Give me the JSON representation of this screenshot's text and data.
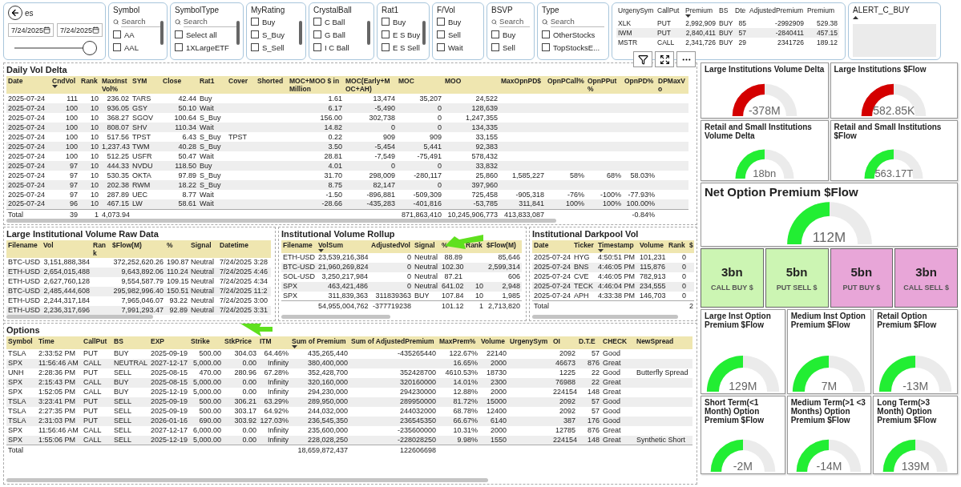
{
  "slicers": [
    {
      "kind": "date",
      "title": "es",
      "from": "7/24/2025",
      "to": "7/24/2025",
      "level": 1
    },
    {
      "kind": "list",
      "title": "Symbol",
      "search": {
        "placeholder": "Search"
      },
      "scrollbar": true,
      "items": [
        {
          "label": "AA",
          "checked": false
        },
        {
          "label": "AAL",
          "checked": false
        }
      ]
    },
    {
      "kind": "list",
      "title": "SymbolType",
      "search": {
        "placeholder": "Search"
      },
      "scrollbar": true,
      "items": [
        {
          "label": "Select all",
          "checked": false
        },
        {
          "label": "1XLargeETF",
          "checked": false
        }
      ]
    },
    {
      "kind": "list",
      "title": "MyRating",
      "scrollbar": true,
      "items": [
        {
          "label": "Buy",
          "checked": false
        },
        {
          "label": "S_Buy",
          "checked": false
        },
        {
          "label": "S_Sell",
          "checked": false
        }
      ]
    },
    {
      "kind": "list",
      "title": "CrystalBall",
      "scrollbar": true,
      "items": [
        {
          "label": "C Ball",
          "checked": false
        },
        {
          "label": "G Ball",
          "checked": false
        },
        {
          "label": "I C Ball",
          "checked": false
        }
      ]
    },
    {
      "kind": "list",
      "title": "Rat1",
      "scrollbar": true,
      "items": [
        {
          "label": "Buy",
          "checked": false
        },
        {
          "label": "E S Buy",
          "checked": false
        },
        {
          "label": "E S Sell",
          "checked": false
        }
      ]
    },
    {
      "kind": "list",
      "title": "F/Vol",
      "scrollbar": false,
      "items": [
        {
          "label": "Buy",
          "checked": false
        },
        {
          "label": "Sell",
          "checked": false
        },
        {
          "label": "Wait",
          "checked": false
        }
      ]
    },
    {
      "kind": "list",
      "title": "BSVP",
      "search": {
        "placeholder": "Search"
      },
      "scrollbar": false,
      "items": [
        {
          "label": "Buy",
          "checked": false
        },
        {
          "label": "Sell",
          "checked": false
        }
      ]
    },
    {
      "kind": "list",
      "title": "Type",
      "search": {
        "placeholder": "Search"
      },
      "scrollbar": false,
      "items": [
        {
          "label": "OtherStocks",
          "checked": false
        },
        {
          "label": "TopStocksE...",
          "checked": false
        }
      ]
    }
  ],
  "urgency_table": {
    "columns": [
      {
        "label": "UrgenySym",
        "sorted": false
      },
      {
        "label": "CallPut",
        "sorted": false
      },
      {
        "label": "Premium",
        "sorted": true
      },
      {
        "label": "BS",
        "sorted": false
      },
      {
        "label": "Dte",
        "sorted": false
      },
      {
        "label": "AdjustedPremium",
        "sorted": false
      },
      {
        "label": "Premium",
        "sorted": false
      }
    ],
    "rows": [
      {
        "urgeny_sym": "XLK",
        "call_put": "PUT",
        "premium": "2,992,909",
        "bs": "BUY",
        "dte": "85",
        "adjusted_premium": "-2992909",
        "column_7": "529.38"
      },
      {
        "urgeny_sym": "IWM",
        "call_put": "PUT",
        "premium": "2,840,411",
        "bs": "BUY",
        "dte": "57",
        "adjusted_premium": "-2840411",
        "column_7": "457.15"
      },
      {
        "urgeny_sym": "MSTR",
        "call_put": "CALL",
        "premium": "2,341,726",
        "bs": "BUY",
        "dte": "29",
        "adjusted_premium": "2341726",
        "column_7": "189.12"
      }
    ]
  },
  "alert_slicer": {
    "title": "ALERT_C_BUY"
  },
  "daily_vol_delta": {
    "title": "Daily Vol Delta",
    "columns": [
      {
        "label": "Date",
        "sorted": false
      },
      {
        "label": "CndVol",
        "sorted": true
      },
      {
        "label": "Rank",
        "sorted": false
      },
      {
        "label": "MaxInst Vol%",
        "sorted": false
      },
      {
        "label": "SYM",
        "sorted": false
      },
      {
        "label": "Close",
        "sorted": false
      },
      {
        "label": "Rat1",
        "sorted": false
      },
      {
        "label": "Cover",
        "sorted": false
      },
      {
        "label": "Shorted",
        "sorted": false
      },
      {
        "label": "MOC+MOO $ in Million",
        "sorted": false
      },
      {
        "label": "MOC(Early+MOC+AH)",
        "sorted": false
      },
      {
        "label": "MOC",
        "sorted": false
      },
      {
        "label": "MOO",
        "sorted": false
      },
      {
        "label": "MaxOpnPD$",
        "sorted": false
      },
      {
        "label": "OpnPCall%",
        "sorted": false
      },
      {
        "label": "OpnPPut%",
        "sorted": false
      },
      {
        "label": "OpnPD%",
        "sorted": false
      },
      {
        "label": "DPMaxVo",
        "sorted": false
      }
    ],
    "rows": [
      {
        "date": "2025-07-24",
        "cnd_vol": "111",
        "rank": "10",
        "max_inst_vol": "236.02",
        "sym": "TARS",
        "close": "42.44",
        "rat1": "Buy",
        "moc_moo_million": "1.61",
        "moc_early": "13,474",
        "moc": "35,207",
        "moo": "24,522"
      },
      {
        "date": "2025-07-24",
        "cnd_vol": "100",
        "rank": "10",
        "max_inst_vol": "936.05",
        "sym": "GSY",
        "close": "50.10",
        "rat1": "Wait",
        "moc_moo_million": "6.17",
        "moc_early": "-5,490",
        "moc": "0",
        "moo": "128,639"
      },
      {
        "date": "2025-07-24",
        "cnd_vol": "100",
        "rank": "10",
        "max_inst_vol": "368.27",
        "sym": "SGOV",
        "close": "100.64",
        "rat1": "S_Buy",
        "moc_moo_million": "156.00",
        "moc_early": "302,738",
        "moc": "0",
        "moo": "1,247,355"
      },
      {
        "date": "2025-07-24",
        "cnd_vol": "100",
        "rank": "10",
        "max_inst_vol": "808.07",
        "sym": "SHV",
        "close": "110.34",
        "rat1": "Wait",
        "moc_moo_million": "14.82",
        "moc_early": "0",
        "moc": "0",
        "moo": "134,335"
      },
      {
        "date": "2025-07-24",
        "cnd_vol": "100",
        "rank": "10",
        "max_inst_vol": "517.56",
        "sym": "TPST",
        "close": "6.43",
        "rat1": "S_Buy",
        "cover": "TPST",
        "moc_moo_million": "0.22",
        "moc_early": "909",
        "moc": "909",
        "moo": "33,155"
      },
      {
        "date": "2025-07-24",
        "cnd_vol": "100",
        "rank": "10",
        "max_inst_vol": "1,237.43",
        "sym": "TWM",
        "close": "40.28",
        "rat1": "S_Buy",
        "moc_moo_million": "3.50",
        "moc_early": "-5,454",
        "moc": "5,441",
        "moo": "92,383"
      },
      {
        "date": "2025-07-24",
        "cnd_vol": "100",
        "rank": "10",
        "max_inst_vol": "512.25",
        "sym": "USFR",
        "close": "50.47",
        "rat1": "Wait",
        "moc_moo_million": "28.81",
        "moc_early": "-7,549",
        "moc": "-75,491",
        "moo": "578,432"
      },
      {
        "date": "2025-07-24",
        "cnd_vol": "97",
        "rank": "10",
        "max_inst_vol": "444.33",
        "sym": "NVDU",
        "close": "118.50",
        "rat1": "Buy",
        "moc_moo_million": "4.01",
        "moc_early": "0",
        "moc": "0",
        "moo": "33,832"
      },
      {
        "date": "2025-07-24",
        "cnd_vol": "97",
        "rank": "10",
        "max_inst_vol": "530.35",
        "sym": "OKTA",
        "close": "97.89",
        "rat1": "S_Buy",
        "moc_moo_million": "31.70",
        "moc_early": "298,009",
        "moc": "-280,117",
        "moo": "25,860",
        "max_opn_pd": "1,585,227",
        "opn_p_call": "58%",
        "opn_p_put": "68%",
        "opn_pd": "58.03%"
      },
      {
        "date": "2025-07-24",
        "cnd_vol": "97",
        "rank": "10",
        "max_inst_vol": "202.38",
        "sym": "RWM",
        "close": "18.22",
        "rat1": "S_Buy",
        "moc_moo_million": "8.75",
        "moc_early": "82,147",
        "moc": "0",
        "moo": "397,960"
      },
      {
        "date": "2025-07-24",
        "cnd_vol": "97",
        "rank": "10",
        "max_inst_vol": "287.89",
        "sym": "UEC",
        "close": "8.77",
        "rat1": "Wait",
        "moc_moo_million": "-1.50",
        "moc_early": "-896,881",
        "moc": "-509,309",
        "moo": "725,458",
        "max_opn_pd": "-905,318",
        "opn_p_call": "-76%",
        "opn_p_put": "-100%",
        "opn_pd": "-77.93%"
      },
      {
        "date": "2025-07-24",
        "cnd_vol": "96",
        "rank": "10",
        "max_inst_vol": "467.15",
        "sym": "LW",
        "close": "58.61",
        "rat1": "Wait",
        "moc_moo_million": "-28.66",
        "moc_early": "-435,283",
        "moc": "-401,816",
        "moo": "-53,785",
        "max_opn_pd": "311,841",
        "opn_p_call": "100%",
        "opn_p_put": "100%",
        "opn_pd": "100.00%"
      }
    ],
    "total": {
      "date": "Total",
      "cnd_vol": "39",
      "rank": "1",
      "max_inst_vol": "4,073.94",
      "moc": "871,863,410",
      "moo": "10,245,906,773",
      "max_opn_pd": "413,833,087",
      "opn_pd": "-0.84%"
    }
  },
  "raw_data": {
    "title": "Large Institutional Volume Raw Data",
    "columns": [
      {
        "label": "Filename",
        "sorted": false
      },
      {
        "label": "Vol",
        "sorted": false
      },
      {
        "label": "Rank",
        "sorted": false
      },
      {
        "label": "$Flow(M)",
        "sorted": false
      },
      {
        "label": "%",
        "sorted": false
      },
      {
        "label": "Signal",
        "sorted": false
      },
      {
        "label": "Datetime",
        "sorted": false
      }
    ],
    "rows": [
      {
        "filename": "BTC-USD",
        "vol": "3,151,888,384",
        "flow": "372,252,620.26",
        "pct": "190.87",
        "signal": "Neutral",
        "datetime": "7/24/2025 3:28"
      },
      {
        "filename": "ETH-USD",
        "vol": "2,654,015,488",
        "flow": "9,643,892.06",
        "pct": "110.24",
        "signal": "Neutral",
        "datetime": "7/24/2025 4:46"
      },
      {
        "filename": "ETH-USD",
        "vol": "2,627,760,128",
        "flow": "9,554,587.79",
        "pct": "109.15",
        "signal": "Neutral",
        "datetime": "7/24/2025 4:34"
      },
      {
        "filename": "BTC-USD",
        "vol": "2,485,444,608",
        "flow": "295,982,996.40",
        "pct": "150.51",
        "signal": "Neutral",
        "datetime": "7/24/2025 11:2"
      },
      {
        "filename": "ETH-USD",
        "vol": "2,244,317,184",
        "flow": "7,965,046.07",
        "pct": "93.22",
        "signal": "Neutral",
        "datetime": "7/24/2025 3:00"
      },
      {
        "filename": "ETH-USD",
        "vol": "2,236,317,696",
        "flow": "7,991,293.47",
        "pct": "92.89",
        "signal": "Neutral",
        "datetime": "7/24/2025 3:31"
      }
    ]
  },
  "rollup": {
    "title": "Institutional Volume Rollup",
    "columns": [
      {
        "label": "Filename",
        "sorted": false
      },
      {
        "label": "VolSum",
        "sorted": true
      },
      {
        "label": "AdjustedVol",
        "sorted": false
      },
      {
        "label": "Signal",
        "sorted": false
      },
      {
        "label": "%",
        "sorted": false
      },
      {
        "label": "Rank",
        "sorted": false
      },
      {
        "label": "$Flow(M)",
        "sorted": false
      }
    ],
    "rows": [
      {
        "filename": "ETH-USD",
        "vol_sum": "23,539,216,384",
        "adjusted_vol": "0",
        "signal": "Neutral",
        "pct": "88.89",
        "flow": "85,646"
      },
      {
        "filename": "BTC-USD",
        "vol_sum": "21,960,269,824",
        "adjusted_vol": "0",
        "signal": "Neutral",
        "pct": "102.30",
        "flow": "2,599,314"
      },
      {
        "filename": "SOL-USD",
        "vol_sum": "3,250,217,984",
        "adjusted_vol": "0",
        "signal": "Neutral",
        "pct": "87.21",
        "flow": "606"
      },
      {
        "filename": "SPX",
        "vol_sum": "463,421,486",
        "adjusted_vol": "0",
        "signal": "Neutral",
        "pct": "641.02",
        "rank": "10",
        "flow": "2,948"
      },
      {
        "filename": "SPX",
        "vol_sum": "311,839,363",
        "adjusted_vol": "311839363",
        "signal": "BUY",
        "pct": "107.84",
        "rank": "10",
        "flow": "1,985"
      }
    ],
    "total": {
      "vol_sum": "54,955,004,762",
      "adjusted_vol": "-377719238",
      "pct": "101.12",
      "rank": "1",
      "flow": "2,713,820"
    }
  },
  "darkpool": {
    "title": "Institutional Darkpool Vol",
    "columns": [
      {
        "label": "Date",
        "sorted": false
      },
      {
        "label": "Ticker",
        "sorted": false
      },
      {
        "label": "Timestamp",
        "sorted": true
      },
      {
        "label": "Volume",
        "sorted": false
      },
      {
        "label": "Rank",
        "sorted": false
      },
      {
        "label": "$",
        "sorted": false
      }
    ],
    "rows": [
      {
        "date": "2025-07-24",
        "ticker": "HYG",
        "timestamp": "4:50:51 PM",
        "volume": "101,231",
        "rank": "0"
      },
      {
        "date": "2025-07-24",
        "ticker": "BNS",
        "timestamp": "4:46:05 PM",
        "volume": "115,876",
        "rank": "0"
      },
      {
        "date": "2025-07-24",
        "ticker": "CVE",
        "timestamp": "4:46:05 PM",
        "volume": "782,913",
        "rank": "0"
      },
      {
        "date": "2025-07-24",
        "ticker": "TECK",
        "timestamp": "4:46:04 PM",
        "volume": "234,555",
        "rank": "0"
      },
      {
        "date": "2025-07-24",
        "ticker": "APH",
        "timestamp": "4:33:38 PM",
        "volume": "146,703",
        "rank": "0"
      }
    ],
    "total": {
      "date": "Total",
      "column_6": "2"
    }
  },
  "options": {
    "title": "Options",
    "columns": [
      {
        "label": "Symbol",
        "sorted": false
      },
      {
        "label": "Time",
        "sorted": false
      },
      {
        "label": "CallPut",
        "sorted": false
      },
      {
        "label": "BS",
        "sorted": false
      },
      {
        "label": "EXP",
        "sorted": false
      },
      {
        "label": "Strike",
        "sorted": false
      },
      {
        "label": "StkPrice",
        "sorted": false
      },
      {
        "label": "ITM",
        "sorted": false
      },
      {
        "label": "Sum of Premium",
        "sorted": true
      },
      {
        "label": "Sum of AdjustedPremium",
        "sorted": false
      },
      {
        "label": "MaxPrem%",
        "sorted": false
      },
      {
        "label": "Volume",
        "sorted": false
      },
      {
        "label": "UrgenySym",
        "sorted": false
      },
      {
        "label": "OI",
        "sorted": false
      },
      {
        "label": "D.T.E",
        "sorted": false
      },
      {
        "label": "CHECK",
        "sorted": false
      },
      {
        "label": "NewSpread",
        "sorted": false
      }
    ],
    "rows": [
      {
        "symbol": "TSLA",
        "time": "2:33:52 PM",
        "call_put": "PUT",
        "bs": "BUY",
        "exp": "2025-09-19",
        "strike": "500.00",
        "stk_price": "304.03",
        "itm": "64.46%",
        "sum_premium": "435,265,440",
        "sum_adjusted": "-435265440",
        "max_prem": "122.67%",
        "volume": "22140",
        "oi": "2092",
        "dte": "57",
        "check": "Good"
      },
      {
        "symbol": "SPX",
        "time": "11:56:46 AM",
        "call_put": "CALL",
        "bs": "NEUTRAL",
        "exp": "2027-12-17",
        "strike": "5,000.00",
        "stk_price": "0.00",
        "itm": "Infinity",
        "sum_premium": "380,400,000",
        "max_prem": "16.65%",
        "volume": "2000",
        "oi": "46673",
        "dte": "876",
        "check": "Great"
      },
      {
        "symbol": "UNH",
        "time": "2:28:36 PM",
        "call_put": "PUT",
        "bs": "SELL",
        "exp": "2025-08-15",
        "strike": "470.00",
        "stk_price": "280.96",
        "itm": "67.28%",
        "sum_premium": "352,428,700",
        "sum_adjusted": "352428700",
        "max_prem": "4610.53%",
        "volume": "18730",
        "oi": "1225",
        "dte": "22",
        "check": "Good",
        "new_spread": "Butterfly Spread"
      },
      {
        "symbol": "SPX",
        "time": "2:15:43 PM",
        "call_put": "CALL",
        "bs": "BUY",
        "exp": "2025-08-15",
        "strike": "5,000.00",
        "stk_price": "0.00",
        "itm": "Infinity",
        "sum_premium": "320,160,000",
        "sum_adjusted": "320160000",
        "max_prem": "14.01%",
        "volume": "2300",
        "oi": "76988",
        "dte": "22",
        "check": "Great"
      },
      {
        "symbol": "SPX",
        "time": "1:52:05 PM",
        "call_put": "CALL",
        "bs": "BUY",
        "exp": "2025-12-19",
        "strike": "5,000.00",
        "stk_price": "0.00",
        "itm": "Infinity",
        "sum_premium": "294,230,000",
        "sum_adjusted": "294230000",
        "max_prem": "12.88%",
        "volume": "2000",
        "oi": "224154",
        "dte": "148",
        "check": "Great"
      },
      {
        "symbol": "TSLA",
        "time": "3:23:41 PM",
        "call_put": "PUT",
        "bs": "SELL",
        "exp": "2025-09-19",
        "strike": "500.00",
        "stk_price": "306.21",
        "itm": "63.29%",
        "sum_premium": "289,950,000",
        "sum_adjusted": "289950000",
        "max_prem": "81.72%",
        "volume": "15000",
        "oi": "2092",
        "dte": "57",
        "check": "Good"
      },
      {
        "symbol": "TSLA",
        "time": "2:27:35 PM",
        "call_put": "PUT",
        "bs": "SELL",
        "exp": "2025-09-19",
        "strike": "500.00",
        "stk_price": "303.17",
        "itm": "64.92%",
        "sum_premium": "244,032,000",
        "sum_adjusted": "244032000",
        "max_prem": "68.78%",
        "volume": "12400",
        "oi": "2092",
        "dte": "57",
        "check": "Good"
      },
      {
        "symbol": "TSLA",
        "time": "2:31:03 PM",
        "call_put": "PUT",
        "bs": "SELL",
        "exp": "2026-01-16",
        "strike": "690.00",
        "stk_price": "303.92",
        "itm": "127.03%",
        "sum_premium": "236,545,350",
        "sum_adjusted": "236545350",
        "max_prem": "66.67%",
        "volume": "6140",
        "oi": "387",
        "dte": "176",
        "check": "Good"
      },
      {
        "symbol": "SPX",
        "time": "11:56:46 AM",
        "call_put": "CALL",
        "bs": "SELL",
        "exp": "2027-12-17",
        "strike": "6,000.00",
        "stk_price": "0.00",
        "itm": "Infinity",
        "sum_premium": "235,600,000",
        "sum_adjusted": "-235600000",
        "max_prem": "10.31%",
        "volume": "2000",
        "oi": "12785",
        "dte": "876",
        "check": "Great"
      },
      {
        "symbol": "SPX",
        "time": "1:55:06 PM",
        "call_put": "CALL",
        "bs": "SELL",
        "exp": "2025-12-19",
        "strike": "5,000.00",
        "stk_price": "0.00",
        "itm": "Infinity",
        "sum_premium": "228,028,250",
        "sum_adjusted": "-228028250",
        "max_prem": "9.98%",
        "volume": "1550",
        "oi": "224154",
        "dte": "148",
        "check": "Great",
        "new_spread": "Synthetic Short"
      }
    ],
    "total": {
      "symbol": "Total",
      "sum_premium": "18,659,872,437",
      "sum_adjusted": "122606698"
    }
  },
  "flow_gauges": [
    {
      "title": "Large Institutions Volume Delta",
      "value": "-378M",
      "level": 0.5,
      "color": "#d40000"
    },
    {
      "title": "Large Institutions $Flow",
      "value": "582.85K",
      "level": 0.5,
      "color": "#d40000"
    },
    {
      "title": "Retail and Small Institutions Volume Delta",
      "value": "18bn",
      "level": 0.5,
      "color": "#22ee33"
    },
    {
      "title": "Retail and Small Institutions $Flow",
      "value": "563.17T",
      "level": 0.5,
      "color": "#22ee33"
    }
  ],
  "net_option": {
    "title": "Net Option Premium $Flow",
    "value": "112M",
    "level": 0.5,
    "color": "#22ee33"
  },
  "kpis": [
    {
      "value": "3bn",
      "label": "CALL BUY $",
      "color": "#ccf5b3"
    },
    {
      "value": "5bn",
      "label": "PUT SELL $",
      "color": "#ccf5b3"
    },
    {
      "value": "5bn",
      "label": "PUT BUY $",
      "color": "#e8a6d8"
    },
    {
      "value": "3bn",
      "label": "CALL SELL $",
      "color": "#e8a6d8"
    }
  ],
  "option_gauges": [
    {
      "title": "Large Inst Option Premium $Flow",
      "value": "129M",
      "level": 0.5,
      "color": "#22ee33"
    },
    {
      "title": "Medium Inst Option Premium $Flow",
      "value": "7M",
      "level": 0.5,
      "color": "#22ee33"
    },
    {
      "title": "Retail Option Premium $Flow",
      "value": "-13M",
      "level": 0.5,
      "color": "#22ee33"
    },
    {
      "title": "Short Term(<1 Month) Option Premium $Flow",
      "value": "-2M",
      "level": 0.5,
      "color": "#22ee33"
    },
    {
      "title": "Medium Term(>1 <3 Months) Option Premium $Flow",
      "value": "-14M",
      "level": 0.5,
      "color": "#22ee33"
    },
    {
      "title": "Long Term(>3 Month) Option Premium $Flow",
      "value": "139M",
      "level": 0.5,
      "color": "#22ee33"
    }
  ]
}
